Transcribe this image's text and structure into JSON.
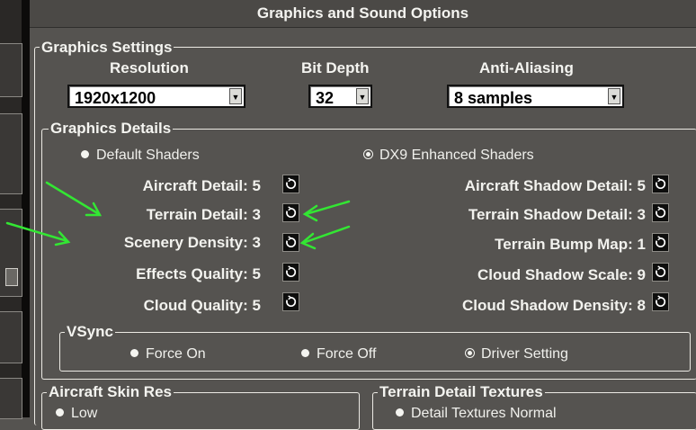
{
  "window": {
    "title": "Graphics and Sound Options"
  },
  "graphics_settings": {
    "legend": "Graphics Settings",
    "resolution": {
      "label": "Resolution",
      "value": "1920x1200"
    },
    "bit_depth": {
      "label": "Bit Depth",
      "value": "32"
    },
    "anti_aliasing": {
      "label": "Anti-Aliasing",
      "value": "8 samples"
    }
  },
  "graphics_details": {
    "legend": "Graphics Details",
    "shaders": [
      {
        "label": "Default Shaders",
        "selected": false
      },
      {
        "label": "DX9 Enhanced Shaders",
        "selected": true
      }
    ],
    "left": [
      {
        "label": "Aircraft Detail:",
        "value": "5"
      },
      {
        "label": "Terrain Detail:",
        "value": "3"
      },
      {
        "label": "Scenery Density:",
        "value": "3"
      },
      {
        "label": "Effects Quality:",
        "value": "5"
      },
      {
        "label": "Cloud Quality:",
        "value": "5"
      }
    ],
    "right": [
      {
        "label": "Aircraft Shadow Detail:",
        "value": "5"
      },
      {
        "label": "Terrain Shadow Detail:",
        "value": "3"
      },
      {
        "label": "Terrain Bump Map:",
        "value": "1"
      },
      {
        "label": "Cloud Shadow Scale:",
        "value": "9"
      },
      {
        "label": "Cloud Shadow Density:",
        "value": "8"
      }
    ],
    "cycle_icon": "cycle-icon"
  },
  "vsync": {
    "legend": "VSync",
    "options": [
      {
        "label": "Force On",
        "selected": false
      },
      {
        "label": "Force Off",
        "selected": false
      },
      {
        "label": "Driver Setting",
        "selected": true
      }
    ]
  },
  "aircraft_skin_res": {
    "legend": "Aircraft Skin Res",
    "option": "Low"
  },
  "terrain_detail_textures": {
    "legend": "Terrain Detail Textures",
    "option": "Detail Textures Normal"
  },
  "annotation_color": "#33e633"
}
